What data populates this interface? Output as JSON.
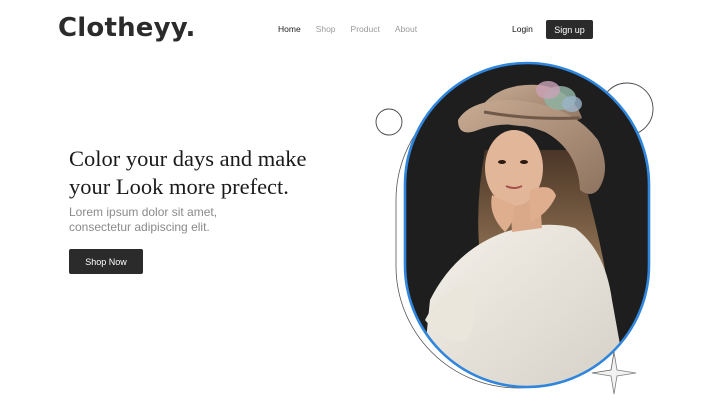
{
  "brand": {
    "logo": "Clotheyy."
  },
  "nav": {
    "items": [
      {
        "label": "Home",
        "active": true
      },
      {
        "label": "Shop",
        "active": false
      },
      {
        "label": "Product",
        "active": false
      },
      {
        "label": "About",
        "active": false
      }
    ]
  },
  "auth": {
    "login_label": "Login",
    "signup_label": "Sign up"
  },
  "hero": {
    "headline_line1": "Color your days and make",
    "headline_line2": "your Look more prefect.",
    "subtext_line1": "Lorem ipsum dolor sit amet,",
    "subtext_line2": "consectetur adipiscing elit.",
    "cta_label": "Shop Now",
    "image_subject": "woman-in-hat-photo"
  },
  "colors": {
    "primary_dark": "#2b2b2b",
    "accent_blue": "#2f86dc",
    "muted_text": "#8a8a8a",
    "photo_background": "#1e1e1e"
  }
}
